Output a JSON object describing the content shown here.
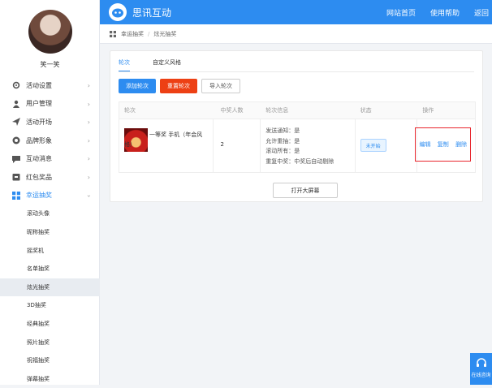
{
  "header": {
    "brand": "思讯互动",
    "nav": [
      "网站首页",
      "使用帮助",
      "返回"
    ]
  },
  "user": {
    "name": "笑一笑"
  },
  "sidebar": {
    "items": [
      {
        "label": "活动设置",
        "icon": "gear-icon"
      },
      {
        "label": "用户管理",
        "icon": "user-icon"
      },
      {
        "label": "活动开场",
        "icon": "send-icon"
      },
      {
        "label": "品牌形象",
        "icon": "brand-icon"
      },
      {
        "label": "互动消息",
        "icon": "message-icon"
      },
      {
        "label": "红包奖品",
        "icon": "gift-icon"
      },
      {
        "label": "幸运抽奖",
        "icon": "grid-icon"
      }
    ],
    "subitems": [
      "滚动头像",
      "昵称抽奖",
      "摇奖机",
      "名单抽奖",
      "炫光抽奖",
      "3D抽奖",
      "经典抽奖",
      "照片抽奖",
      "祝福抽奖",
      "弹幕抽奖"
    ]
  },
  "breadcrumb": {
    "root": "幸运抽奖",
    "current": "炫光抽奖"
  },
  "tabs": [
    "轮次",
    "自定义风格"
  ],
  "buttons": {
    "add": "添加轮次",
    "reset": "重置轮次",
    "import": "导入轮次"
  },
  "table": {
    "headers": [
      "轮次",
      "中奖人数",
      "轮次信息",
      "状态",
      "操作"
    ],
    "row": {
      "prize": "一等奖 手机（年会风格）",
      "count": "2",
      "info": [
        "发送通知：是",
        "允许重抽：是",
        "滚动所有：是",
        "重复中奖：中奖后自动剔除"
      ],
      "status": "未开始",
      "ops": [
        "编辑",
        "复制",
        "删除"
      ]
    }
  },
  "open_screen": "打开大屏幕",
  "float_label": "在线咨询",
  "colors": {
    "accent": "#2d8cf0",
    "danger": "#ed4014",
    "highlight": "#e8262d"
  }
}
